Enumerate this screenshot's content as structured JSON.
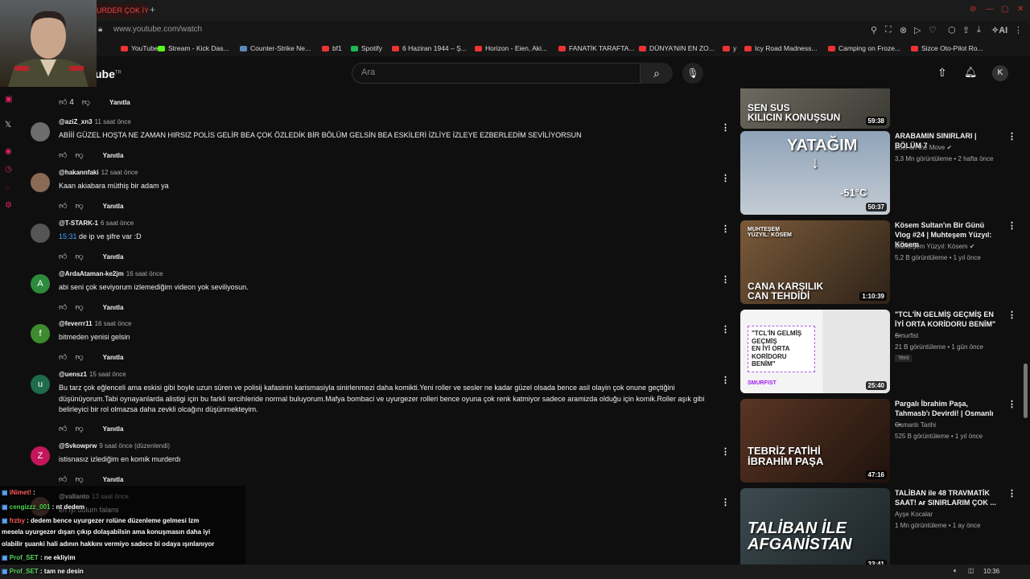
{
  "browser": {
    "active_tab_label": "URDER ÇOK İY",
    "url": "www.youtube.com/watch",
    "bookmarks": [
      "ck",
      "YouTube",
      "Stream - Kick Das...",
      "Counter-Strike Ne...",
      "bf1",
      "Spotify",
      "6 Haziran 1944 – Ş...",
      "Horizon - Eien, Aki...",
      "FANATİK TARAFTA...",
      "DÜNYA'NIN EN ZO...",
      "y",
      "Icy Road Madness...",
      "Camping on Froze...",
      "Sizce Oto-Pilot Ro..."
    ],
    "ai_label": "AI"
  },
  "youtube": {
    "logo_text": "ube",
    "logo_tm": "TR",
    "search_placeholder": "Ara",
    "avatar_letter": "K"
  },
  "comments": [
    {
      "avatar_letter": "",
      "avatar_color": "#0f0f0f",
      "username": "",
      "time": "",
      "text": "",
      "likes": "4",
      "reply": "Yanıtla"
    },
    {
      "avatar_letter": "",
      "avatar_color": "#6d6d6d",
      "username": "@aziZ_xn3",
      "time": "11 saat önce",
      "text": "ABİİİ GÜZEL HOŞTA NE ZAMAN HIRSIZ POLİS GELİR BEA ÇOK ÖZLEDİK BİR BÖLÜM GELSİN BEA ESKİLERİ İZLİYE İZLEYE EZBERLEDİM SEVİLİYORSUN",
      "likes": "",
      "reply": "Yanıtla"
    },
    {
      "avatar_letter": "",
      "avatar_color": "#8a6a55",
      "username": "@hakannfaki",
      "time": "12 saat önce",
      "text": "Kaan akiabara müthiş bir adam ya",
      "likes": "",
      "reply": "Yanıtla"
    },
    {
      "avatar_letter": "",
      "avatar_color": "#555",
      "username": "@T-STARK-1",
      "time": "6 saat önce",
      "timestamp": "15:31",
      "text": "de ip ve şifre var :D",
      "likes": "",
      "reply": "Yanıtla"
    },
    {
      "avatar_letter": "A",
      "avatar_color": "#2e8b3d",
      "username": "@ArdaAtaman-ke2jm",
      "time": "16 saat önce",
      "text": "abi seni çok seviyorum izlemediğim videon yok seviliyosun.",
      "likes": "",
      "reply": "Yanıtla"
    },
    {
      "avatar_letter": "f",
      "avatar_color": "#3d8b2e",
      "username": "@feverrr11",
      "time": "16 saat önce",
      "text": "bitmeden  yenisi gelsin",
      "likes": "",
      "reply": "Yanıtla"
    },
    {
      "avatar_letter": "u",
      "avatar_color": "#1f6b4a",
      "username": "@uensz1",
      "time": "15 saat önce",
      "text": "Bu tarz çok eğlenceli ama eskisi gibi boyle uzun süren ve polisij kafasinin karismasiyla sinirlenmezi daha komikti.Yeni roller ve sesler ne kadar güzel olsada bence asil olayin çok onune geçtiğini düşünüyorum.Tabi oynayanlarda alistigi için bu farkli tercihleride normal buluyorum.Mafya bombaci  ve uyurgezer rolleri bence oyuna çok renk katmiyor sadece aramizda olduğu için komik.Roller aşık gibi belirleyici bir rol olmazsa daha zevkli olcağını düşünmekteyim.",
      "likes": "",
      "reply": "Yanıtla"
    },
    {
      "avatar_letter": "Z",
      "avatar_color": "#c2185b",
      "username": "@Svkowprw",
      "time": "9 saat önce (düzenlendi)",
      "text": "istisnasız izlediğim en komik murderdı",
      "likes": "",
      "reply": "Yanıtla"
    },
    {
      "avatar_letter": "",
      "avatar_color": "#6d4c41",
      "username": "@vallanto",
      "time": "13 saat önce",
      "text": "en iyi bolum falans",
      "likes": "",
      "reply": ""
    }
  ],
  "videos": [
    {
      "thumb_text": "SEN SUS\nKILICIN KONUŞSUN",
      "duration": "59:38",
      "title": "",
      "channel": "",
      "meta": "",
      "badge": ""
    },
    {
      "thumb_text": "YATAĞIM",
      "thumb_sub": "-51°C",
      "duration": "50:37",
      "title": "ARABAMIN SINIRLARI | BÖLÜM 7",
      "channel": "Zoef on the Move",
      "verified": true,
      "meta": "3,3 Mn görüntüleme • 2 hafta önce",
      "badge": ""
    },
    {
      "thumb_text": "CANA KARŞILIK\nCAN TEHDİDİ",
      "thumb_top": "MUHTEŞEM\nYÜZYIL: KÖSEM",
      "duration": "1:10:39",
      "title": "Kösem Sultan'ın Bir Günü Vlog #24 | Muhteşem Yüzyıl: Kösem",
      "channel": "Muhteşem Yüzyıl: Kösem",
      "verified": true,
      "meta": "5,2 B görüntüleme • 1 yıl önce",
      "badge": ""
    },
    {
      "thumb_text": "\"TCL'İN GELMİŞ GEÇMİŞ\nEN İYİ ORTA KORİDORU BENİM\"",
      "thumb_top": "SMURFIST",
      "duration": "25:40",
      "title": "\"TCL'İN GELMİŞ GEÇMİŞ EN İYİ ORTA KORİDORU BENİM\" ...",
      "channel": "Smurfist",
      "verified": false,
      "meta": "21 B görüntüleme • 1 gün önce",
      "badge": "Yeni"
    },
    {
      "thumb_text": "TEBRİZ FATİHİ\nİBRAHİM PAŞA",
      "duration": "47:16",
      "title": "Pargalı İbrahim Paşa, Tahmasb'ı Devirdi! | Osmanlı ...",
      "channel": "Osmanlı Tarihi",
      "verified": false,
      "meta": "525 B görüntüleme • 1 yıl önce",
      "badge": ""
    },
    {
      "thumb_text": "TALİBAN İLE\nAFGANİSTAN",
      "duration": "33:41",
      "title": "TALİBAN ile 48 TRAVMATİK SAAT! ᴀғ SINIRLARIM ÇOK ...",
      "channel": "Ayşe Kocalar",
      "verified": false,
      "meta": "1 Mn görüntüleme • 1 ay önce",
      "badge": ""
    }
  ],
  "chat": [
    {
      "name": "iNimet!",
      "text": " :",
      "cls": "n1"
    },
    {
      "name": "cengizzz_001",
      "text": " : nt dedem",
      "cls": "n2"
    },
    {
      "name": "frzby",
      "text": " : dedem bence uyurgezer rolüne düzenleme gelmesi lzm",
      "cls": "n3"
    },
    {
      "name": "",
      "text": "mesela uyurgezer dışarı çıkıp dolaşabilsin ama konuşmasın daha iyi",
      "cls": ""
    },
    {
      "name": "",
      "text": "olabilir şuanki hali adının hakkını vermiyo sadece bi odaya ışınlanıyor",
      "cls": ""
    },
    {
      "name": "Prof_SET",
      "text": " : ne ekliyim",
      "cls": "n4"
    },
    {
      "name": "Prof_SET",
      "text": " : tam ne desin",
      "cls": "n4"
    }
  ],
  "taskbar": {
    "time": "10:36"
  }
}
